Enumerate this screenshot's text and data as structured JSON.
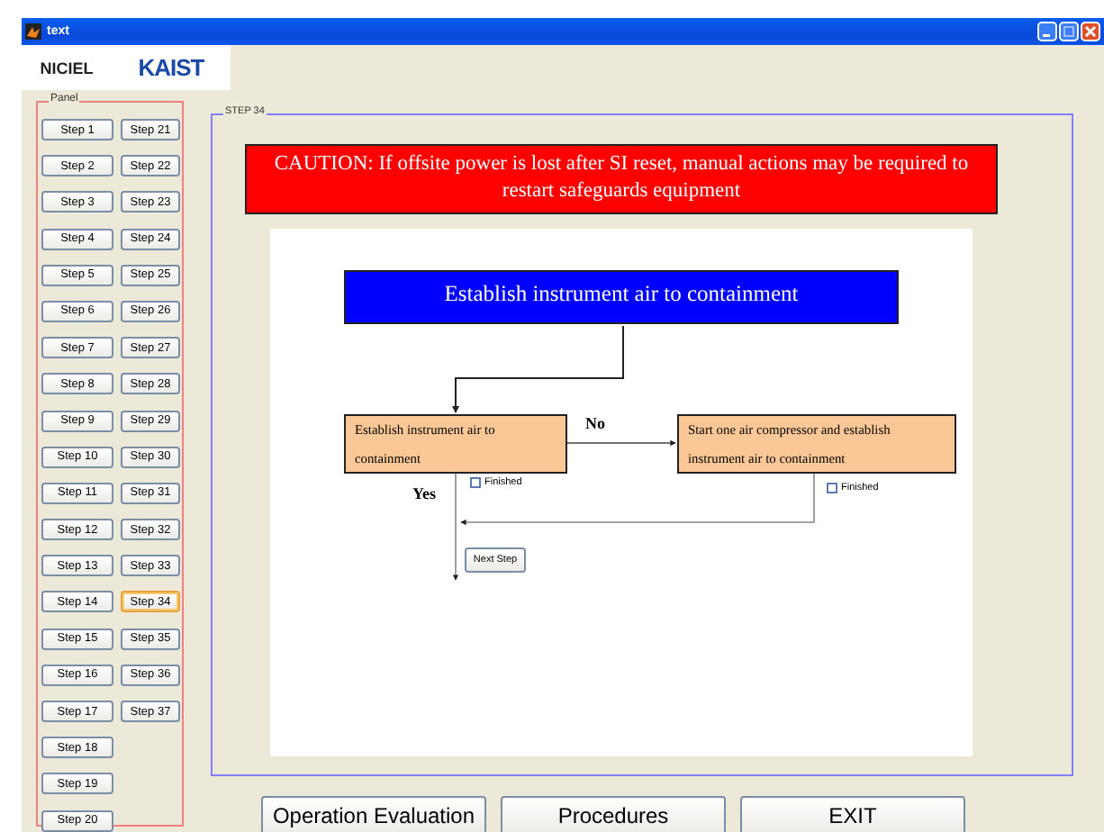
{
  "window": {
    "title": "text"
  },
  "logos": [
    "NICIEL",
    "KAIST"
  ],
  "panel": {
    "title": "Panel",
    "steps": [
      {
        "label": "Step 1",
        "selected": false
      },
      {
        "label": "Step 2",
        "selected": false
      },
      {
        "label": "Step 3",
        "selected": false
      },
      {
        "label": "Step 4",
        "selected": false
      },
      {
        "label": "Step 5",
        "selected": false
      },
      {
        "label": "Step 6",
        "selected": false
      },
      {
        "label": "Step 7",
        "selected": false
      },
      {
        "label": "Step 8",
        "selected": false
      },
      {
        "label": "Step 9",
        "selected": false
      },
      {
        "label": "Step 10",
        "selected": false
      },
      {
        "label": "Step 11",
        "selected": false
      },
      {
        "label": "Step 12",
        "selected": false
      },
      {
        "label": "Step 13",
        "selected": false
      },
      {
        "label": "Step 14",
        "selected": false
      },
      {
        "label": "Step 15",
        "selected": false
      },
      {
        "label": "Step 16",
        "selected": false
      },
      {
        "label": "Step 17",
        "selected": false
      },
      {
        "label": "Step 18",
        "selected": false
      },
      {
        "label": "Step 19",
        "selected": false
      },
      {
        "label": "Step 20",
        "selected": false
      },
      {
        "label": "Step 21",
        "selected": false
      },
      {
        "label": "Step 22",
        "selected": false
      },
      {
        "label": "Step 23",
        "selected": false
      },
      {
        "label": "Step 24",
        "selected": false
      },
      {
        "label": "Step 25",
        "selected": false
      },
      {
        "label": "Step 26",
        "selected": false
      },
      {
        "label": "Step 27",
        "selected": false
      },
      {
        "label": "Step 28",
        "selected": false
      },
      {
        "label": "Step 29",
        "selected": false
      },
      {
        "label": "Step 30",
        "selected": false
      },
      {
        "label": "Step 31",
        "selected": false
      },
      {
        "label": "Step 32",
        "selected": false
      },
      {
        "label": "Step 33",
        "selected": false
      },
      {
        "label": "Step 34",
        "selected": true
      },
      {
        "label": "Step 35",
        "selected": false
      },
      {
        "label": "Step 36",
        "selected": false
      },
      {
        "label": "Step 37",
        "selected": false
      }
    ]
  },
  "step": {
    "title": "STEP 34",
    "caution": "CAUTION: If offsite power is lost after SI reset, manual actions may be required to restart safeguards equipment",
    "flowchart": {
      "heading": "Establish instrument air to containment",
      "check_box_text": "Establish instrument air to containment",
      "action_box_text": "Start one air compressor and establish instrument air to containment",
      "no_label": "No",
      "yes_label": "Yes",
      "checkboxes": [
        {
          "label": "Finished",
          "checked": false
        },
        {
          "label": "Finished",
          "checked": false
        }
      ],
      "next_button": "Next Step"
    }
  },
  "buttons": [
    "Operation Evaluation",
    "Procedures",
    "EXIT"
  ]
}
